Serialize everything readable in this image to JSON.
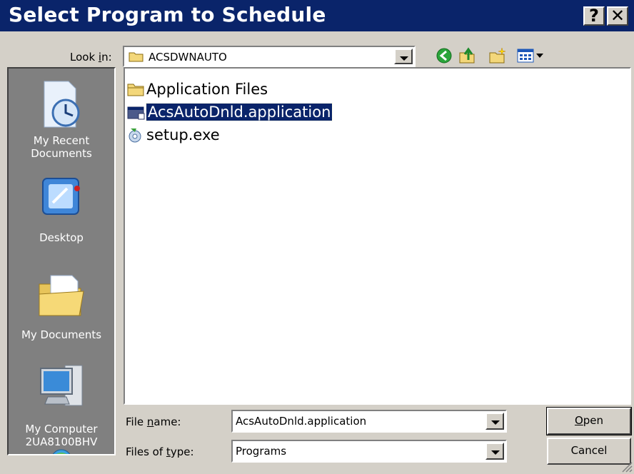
{
  "window": {
    "title": "Select Program to Schedule",
    "help_glyph": "?",
    "close_glyph": "✕"
  },
  "lookin": {
    "label_pre": "Look ",
    "label_key": "i",
    "label_post": "n:",
    "value": "ACSDWNAUTO"
  },
  "places": [
    {
      "label": "My Recent Documents",
      "icon": "recent-documents-icon"
    },
    {
      "label": "Desktop",
      "icon": "desktop-icon"
    },
    {
      "label": "My Documents",
      "icon": "my-documents-icon"
    },
    {
      "label": "My Computer 2UA8100BHV",
      "icon": "my-computer-icon"
    }
  ],
  "files": [
    {
      "name": "Application Files",
      "icon": "folder-icon",
      "selected": false
    },
    {
      "name": "AcsAutoDnld.application",
      "icon": "application-file-icon",
      "selected": true
    },
    {
      "name": "setup.exe",
      "icon": "setup-exe-icon",
      "selected": false
    }
  ],
  "filename": {
    "label_pre": "File ",
    "label_key": "n",
    "label_post": "ame:",
    "value": "AcsAutoDnld.application"
  },
  "filetype": {
    "label_pre": "Files of ",
    "label_key": "t",
    "label_post": "ype:",
    "value": "Programs"
  },
  "buttons": {
    "open_key": "O",
    "open_rest": "pen",
    "cancel": "Cancel"
  }
}
